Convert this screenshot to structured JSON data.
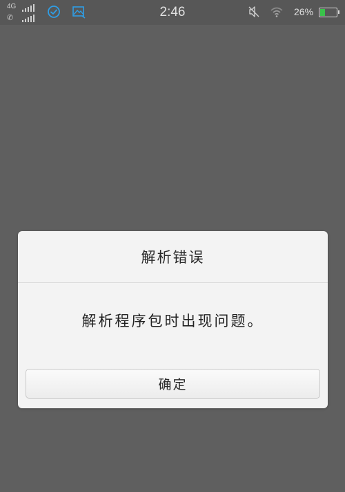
{
  "status_bar": {
    "network_label": "4G",
    "time": "2:46",
    "battery_percent_text": "26%",
    "battery_level": 0.26,
    "icons": [
      "signal-icon",
      "phone-signal-icon",
      "check-circle-icon",
      "screenshot-icon",
      "mute-icon",
      "wifi-icon",
      "battery-icon"
    ],
    "accent_color": "#2f9ee6",
    "battery_color": "#39c24a"
  },
  "dialog": {
    "title": "解析错误",
    "message": "解析程序包时出现问题。",
    "confirm_label": "确定"
  },
  "colors": {
    "overlay": "#5f5f5f",
    "dialog_bg": "#f3f3f3"
  }
}
